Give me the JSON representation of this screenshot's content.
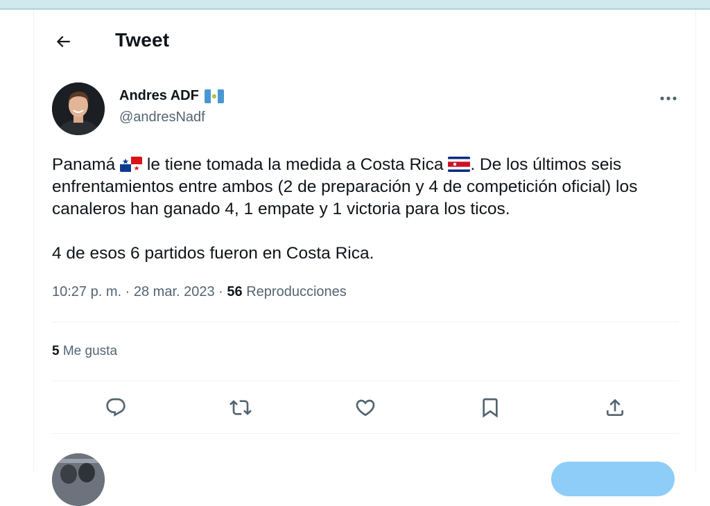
{
  "header": {
    "title": "Tweet"
  },
  "author": {
    "name": "Andres ADF",
    "handle": "@andresNadf"
  },
  "tweet": {
    "p1_a": "Panamá ",
    "p1_b": " le tiene tomada la medida a Costa Rica ",
    "p1_c": ". De los últimos seis enfrentamientos entre ambos (2 de preparación y 4 de competición oficial) los canaleros han ganado 4, 1 empate y 1 victoria para los ticos.",
    "p2": "4 de esos 6 partidos fueron en Costa Rica.",
    "time": "10:27 p. m.",
    "separator": "·",
    "date": "28 mar. 2023",
    "views_count": "56",
    "views_label": "Reproducciones"
  },
  "stats": {
    "likes_count": "5",
    "likes_label": "Me gusta"
  },
  "icons": {
    "back": "arrow-left-icon",
    "more": "more-horizontal-icon",
    "reply": "reply-icon",
    "retweet": "retweet-icon",
    "like": "heart-icon",
    "bookmark": "bookmark-icon",
    "share": "share-icon"
  },
  "colors": {
    "text": "#0f1419",
    "secondary": "#536471",
    "divider": "#eff3f4",
    "reply_button": "#8ecdf8"
  }
}
